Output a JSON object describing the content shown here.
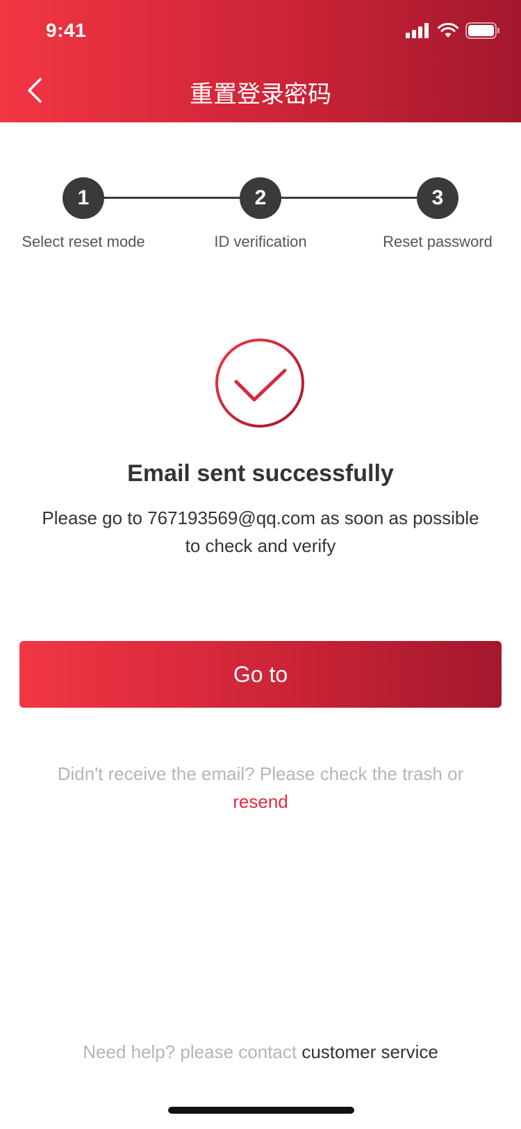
{
  "status_bar": {
    "time": "9:41"
  },
  "nav": {
    "title": "重置登录密码",
    "back_icon": "chevron-left-icon"
  },
  "steps": [
    {
      "number": "1",
      "label": "Select reset mode"
    },
    {
      "number": "2",
      "label": "ID verification"
    },
    {
      "number": "3",
      "label": "Reset password"
    }
  ],
  "result": {
    "icon": "check-circle-icon",
    "title": "Email sent successfully",
    "desc_line1": "Please go to 767193569@qq.com as soon as possible",
    "desc_line2": "to check and verify"
  },
  "goto_button": {
    "label": "Go to"
  },
  "resend": {
    "prompt": "Didn't receive the email? Please check the trash or",
    "link": "resend"
  },
  "help": {
    "prompt": "Need help? please contact",
    "link": "customer service"
  },
  "colors": {
    "brand_start": "#f23644",
    "brand_end": "#a3182d",
    "step_dark": "#3a3a3a",
    "link_red": "#e02d3c"
  }
}
